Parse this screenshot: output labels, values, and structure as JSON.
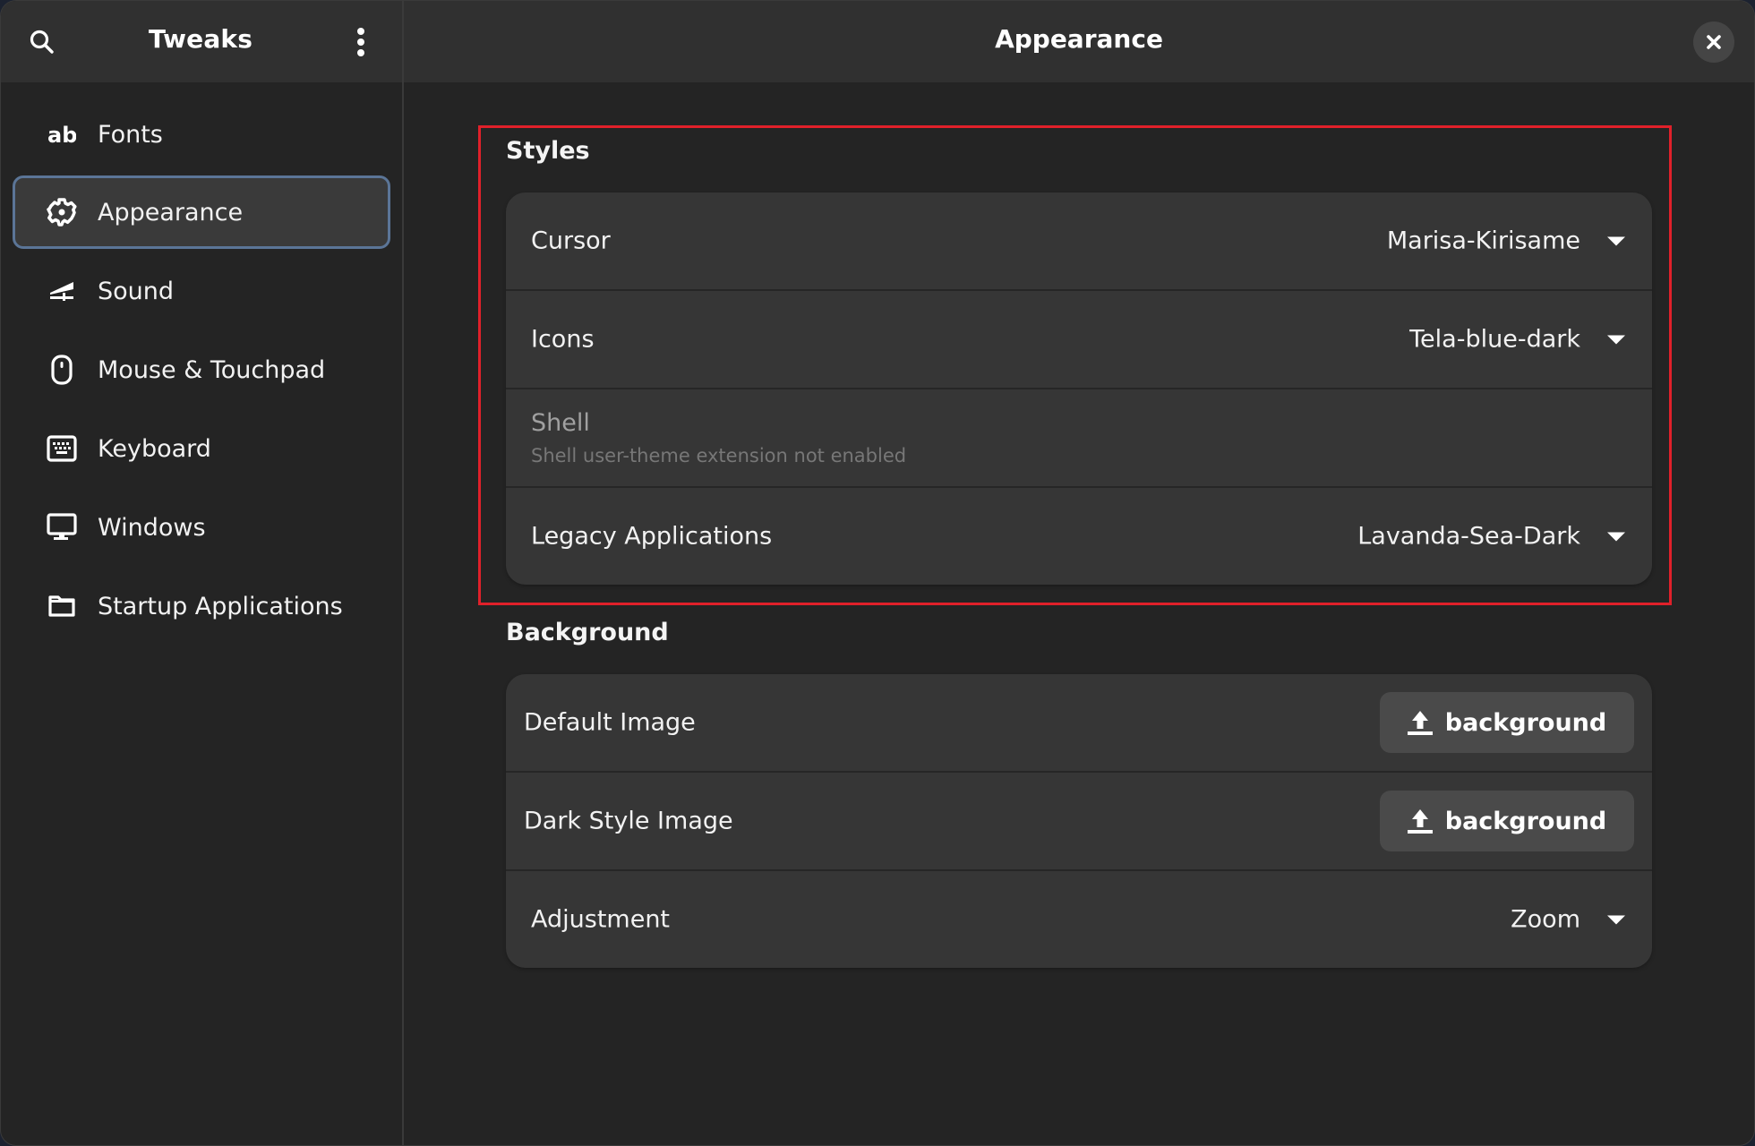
{
  "app": {
    "title": "Tweaks"
  },
  "header": {
    "page_title": "Appearance"
  },
  "sidebar": {
    "items": [
      {
        "label": "Fonts",
        "icon": "fonts-icon",
        "selected": false
      },
      {
        "label": "Appearance",
        "icon": "gear-icon",
        "selected": true
      },
      {
        "label": "Sound",
        "icon": "volume-icon",
        "selected": false
      },
      {
        "label": "Mouse & Touchpad",
        "icon": "mouse-icon",
        "selected": false
      },
      {
        "label": "Keyboard",
        "icon": "keyboard-icon",
        "selected": false
      },
      {
        "label": "Windows",
        "icon": "monitor-icon",
        "selected": false
      },
      {
        "label": "Startup Applications",
        "icon": "folder-icon",
        "selected": false
      }
    ]
  },
  "styles": {
    "title": "Styles",
    "rows": [
      {
        "label": "Cursor",
        "value": "Marisa-Kirisame"
      },
      {
        "label": "Icons",
        "value": "Tela-blue-dark"
      },
      {
        "label": "Shell",
        "subtitle": "Shell user-theme extension not enabled",
        "disabled": true
      },
      {
        "label": "Legacy Applications",
        "value": "Lavanda-Sea-Dark"
      }
    ]
  },
  "background": {
    "title": "Background",
    "rows": [
      {
        "label": "Default Image",
        "button_label": "background"
      },
      {
        "label": "Dark Style Image",
        "button_label": "background"
      },
      {
        "label": "Adjustment",
        "value": "Zoom"
      }
    ]
  },
  "colors": {
    "accent_border": "#5b7597",
    "annotation": "#e0202a"
  }
}
